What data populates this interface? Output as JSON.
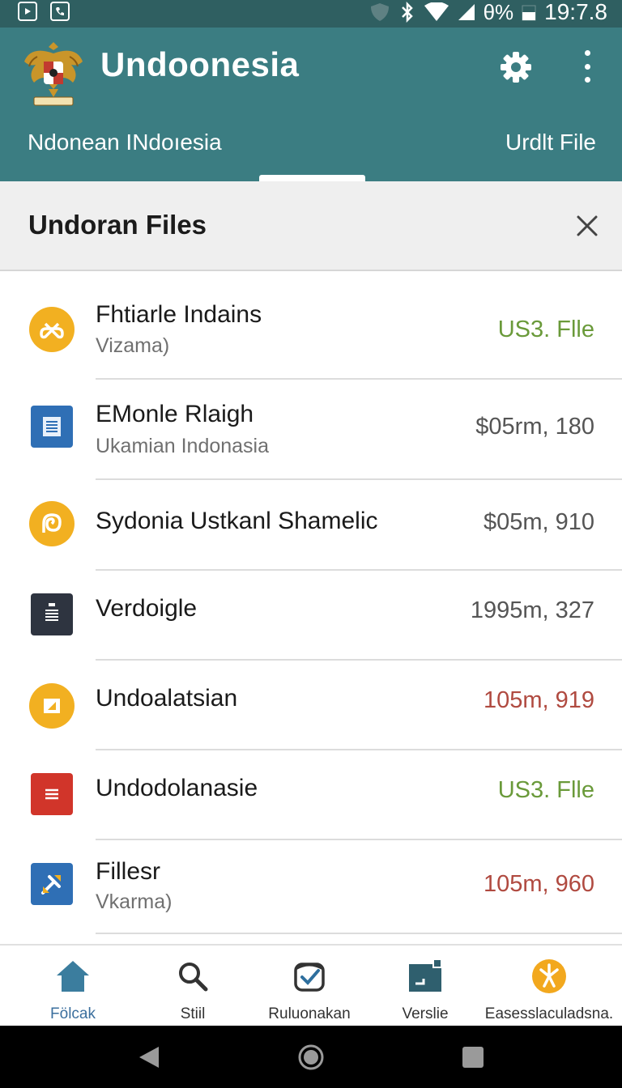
{
  "status_bar": {
    "battery": "θ%",
    "time": "19:7.8"
  },
  "app_bar": {
    "title": "Undoonesia",
    "tabs": [
      {
        "label": "Ndonean INdoıesia",
        "active": true
      },
      {
        "label": "Urdlt File",
        "active": false
      }
    ],
    "accent": "#3b7d82"
  },
  "section": {
    "title": "Undoran Files"
  },
  "files": [
    {
      "title": "Fhtiarle Indains",
      "subtitle": "Vizama)",
      "value": "US3. Flle",
      "value_color": "#6a9a3a",
      "icon": "infinity-icon"
    },
    {
      "title": "EMonle Rlaigh",
      "subtitle": "Ukamian  Indonasia",
      "value": "$05rm, 180",
      "value_color": "#555555",
      "icon": "document-icon"
    },
    {
      "title": "Sydonia  Ustkanl Shamelic",
      "subtitle": "",
      "value": "$05m, 910",
      "value_color": "#555555",
      "icon": "spiral-icon"
    },
    {
      "title": "Verdoigle",
      "subtitle": "",
      "value": "1995m, 327",
      "value_color": "#555555",
      "icon": "clipboard-icon"
    },
    {
      "title": "Undoalatsian",
      "subtitle": "",
      "value": "105m, 919",
      "value_color": "#b04a40",
      "icon": "folder-icon"
    },
    {
      "title": "Undodolanasie",
      "subtitle": "",
      "value": "US3. Flle",
      "value_color": "#6a9a3a",
      "icon": "list-icon"
    },
    {
      "title": "Fillesr",
      "subtitle": "Vkarma)",
      "value": "105m, 960",
      "value_color": "#b04a40",
      "icon": "tools-icon"
    }
  ],
  "bottom_nav": [
    {
      "label": "Fölcak",
      "icon": "home-icon",
      "active": true
    },
    {
      "label": "Stiil",
      "icon": "search-icon",
      "active": false
    },
    {
      "label": "Ruluonakan",
      "icon": "check-box-icon",
      "active": false
    },
    {
      "label": "Verslie",
      "icon": "window-icon",
      "active": false
    },
    {
      "label": "Easesslaculadsna.",
      "icon": "star-badge-icon",
      "active": false
    }
  ]
}
